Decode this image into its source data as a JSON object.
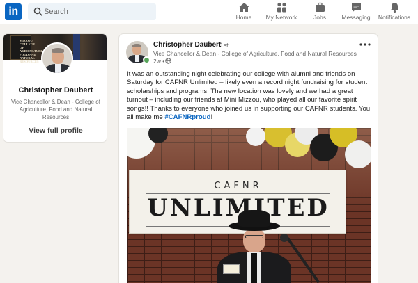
{
  "nav": {
    "logo_text": "in",
    "search_placeholder": "Search",
    "items": [
      {
        "label": "Home",
        "icon": "home-icon"
      },
      {
        "label": "My Network",
        "icon": "network-icon"
      },
      {
        "label": "Jobs",
        "icon": "jobs-icon"
      },
      {
        "label": "Messaging",
        "icon": "messaging-icon"
      },
      {
        "label": "Notifications",
        "icon": "bell-icon"
      }
    ]
  },
  "profile": {
    "name": "Christopher Daubert",
    "headline": "Vice Chancellor & Dean - College of Agriculture, Food and Natural Resources",
    "view_link": "View full profile",
    "cover_banner_text": "MIZZOU COLLEGE OF AGRICULTURE FOOD AND NATURAL RESOURCES"
  },
  "post": {
    "author": "Christopher Daubert",
    "degree": "• 1st",
    "headline": "Vice Chancellor & Dean - College of Agriculture, Food and Natural Resources",
    "time": "2w •",
    "text_before": "It was an outstanding night celebrating our college with alumni and friends on Saturday for CAFNR Unlimited – likely even a record night fundraising for student scholarships and programs! The new location was lovely and we had a great turnout – including our friends at Mini Mizzou, who played all our favorite spirit songs!! Thanks to everyone who joined us in supporting our CAFNR students. You all make me ",
    "hashtag": "#CAFNRproud",
    "text_after": "!",
    "photo": {
      "banner_small": "CAFNR",
      "banner_big": "UNLIMITED"
    }
  },
  "colors": {
    "brand": "#0a66c2",
    "background": "#f4f2ee",
    "online": "#57a55a"
  }
}
